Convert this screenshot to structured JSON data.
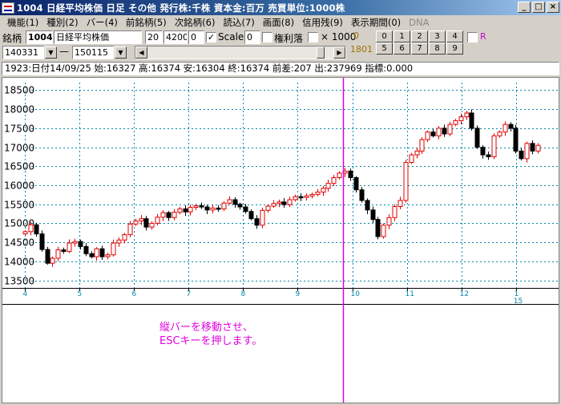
{
  "window": {
    "title": "1004 日経平均株価  日足  その他  発行株:千株  資本金:百万  売買単位:1000株",
    "buttons": [
      "_",
      "□",
      "×"
    ]
  },
  "menu": [
    {
      "label": "機能(1)",
      "enabled": true
    },
    {
      "label": "種別(2)",
      "enabled": true
    },
    {
      "label": "バー(4)",
      "enabled": true
    },
    {
      "label": "前銘柄(5)",
      "enabled": true
    },
    {
      "label": "次銘柄(6)",
      "enabled": true
    },
    {
      "label": "読込(7)",
      "enabled": true
    },
    {
      "label": "画面(8)",
      "enabled": true
    },
    {
      "label": "信用残(9)",
      "enabled": true
    },
    {
      "label": "表示期間(0)",
      "enabled": true
    },
    {
      "label": "DNA",
      "enabled": false
    }
  ],
  "toolbar": {
    "stock_label": "銘柄",
    "stock_code": "1004",
    "stock_name": "日経平均株価",
    "field_a": "20",
    "field_b": "4200",
    "field_c": "0",
    "scale_label": "Scale",
    "scale_checked": "✓",
    "scale_value": "0",
    "rights_label": "権利落",
    "x1000_label": "× 1000",
    "top_digit": "0",
    "count": "1801",
    "num_buttons_row1": [
      "0",
      "1",
      "2",
      "3",
      "4"
    ],
    "num_buttons_row2": [
      "5",
      "6",
      "7",
      "8",
      "9"
    ],
    "r_label": "R",
    "date_from": "140331",
    "dash": "—",
    "date_to": "150115"
  },
  "info": {
    "text": "1923:日付14/09/25 始:16327 高:16374 安:16304 終:16374 前差:207 出:237969 指標:0.000"
  },
  "note": {
    "line1": "縦バーを移動させ、",
    "line2": "ESCキーを押します。"
  },
  "colors": {
    "up": "#e00000",
    "down": "#000000",
    "cursor": "#e000e0",
    "grid": "#0088aa"
  },
  "chart_data": {
    "type": "candlestick",
    "ylim": [
      13300,
      18700
    ],
    "y_ticks": [
      13500,
      14000,
      14500,
      15000,
      15500,
      16000,
      16500,
      17000,
      17500,
      18000,
      18500
    ],
    "x_month_labels": [
      "4",
      "5",
      "6",
      "7",
      "8",
      "9",
      "10",
      "11",
      "12",
      "1"
    ],
    "x_year_label": "15",
    "cursor_date": "14/09/25",
    "closes": [
      14780,
      14960,
      14720,
      14310,
      13950,
      14080,
      14300,
      14260,
      14480,
      14520,
      14390,
      14200,
      14120,
      14330,
      14120,
      14170,
      14480,
      14560,
      14700,
      14980,
      15060,
      15120,
      14900,
      15000,
      15160,
      15280,
      15150,
      15290,
      15380,
      15300,
      15420,
      15460,
      15430,
      15350,
      15400,
      15380,
      15530,
      15620,
      15500,
      15430,
      15310,
      15120,
      14950,
      15340,
      15450,
      15520,
      15560,
      15490,
      15620,
      15700,
      15680,
      15720,
      15760,
      15820,
      15920,
      16050,
      16200,
      16320,
      16374,
      16200,
      15880,
      15600,
      15350,
      15100,
      14650,
      14950,
      15150,
      15440,
      15600,
      16600,
      16800,
      16900,
      17200,
      17400,
      17300,
      17500,
      17350,
      17600,
      17700,
      17800,
      17900,
      17500,
      17000,
      16800,
      16750,
      17300,
      17400,
      17600,
      17500,
      16900,
      16700,
      17100,
      16900,
      17050
    ]
  }
}
